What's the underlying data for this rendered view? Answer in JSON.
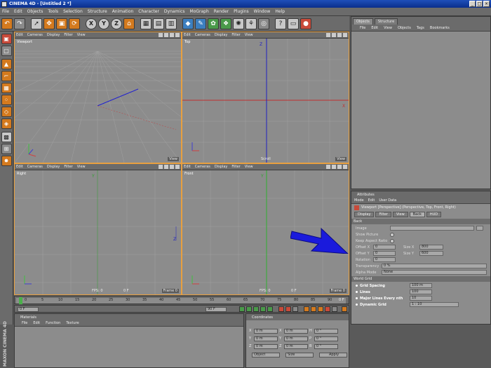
{
  "window": {
    "title": "CINEMA 4D - [Untitled 2 *]",
    "controls": [
      "_",
      "□",
      "×"
    ]
  },
  "menu": [
    "File",
    "Edit",
    "Objects",
    "Tools",
    "Selection",
    "Structure",
    "Animation",
    "Character",
    "Dynamics",
    "MoGraph",
    "Render",
    "Plugins",
    "Window",
    "Help"
  ],
  "viewports": {
    "top_left": {
      "menu": [
        "Edit",
        "Cameras",
        "Display",
        "Filter",
        "View"
      ],
      "label": "Viewport",
      "view_btn": "View"
    },
    "top_right": {
      "menu": [
        "Edit",
        "Cameras",
        "Display",
        "Filter",
        "View"
      ],
      "label": "Top",
      "view_btn": "View",
      "bottom": "Scroll"
    },
    "bottom_left": {
      "menu": [
        "Edit",
        "Cameras",
        "Display",
        "Filter",
        "View"
      ],
      "label": "Right",
      "fps": "FPS: 0",
      "fps2": "0 F",
      "view_btn": "Frame 0"
    },
    "bottom_right": {
      "menu": [
        "Edit",
        "Cameras",
        "Display",
        "Filter",
        "View"
      ],
      "label": "Front",
      "fps": "FPS: 0",
      "fps2": "0 F",
      "view_btn": "Frame 0"
    }
  },
  "objects_panel": {
    "tabs": [
      "Objects",
      "Structure"
    ],
    "menu": [
      "File",
      "Edit",
      "View",
      "Objects",
      "Tags",
      "Bookmarks"
    ]
  },
  "attributes_panel": {
    "title": "Attributes",
    "menu": [
      "Mode",
      "Edit",
      "User Data"
    ],
    "object_line": "Viewport [Perspective] (Perspective, Top, Front, Right)",
    "subtabs": [
      "Display",
      "Filter",
      "View",
      "Back",
      "HUD"
    ],
    "section_back": "Back",
    "image_label": "Image",
    "show_picture_label": "Show Picture",
    "keep_aspect_label": "Keep Aspect Ratio",
    "offset_x_label": "Offset X",
    "offset_x": "0",
    "size_x_label": "Size X",
    "size_x": "800",
    "offset_y_label": "Offset Y",
    "offset_y": "0",
    "size_y_label": "Size Y",
    "size_y": "600",
    "rotation_label": "Rotation",
    "rotation": "0",
    "transparency_label": "Transparency",
    "transparency": "0 %",
    "alpha_label": "Alpha Mode",
    "alpha": "None",
    "section_grid": "World Grid",
    "grid_spacing_label": "Grid Spacing",
    "grid_spacing": "100 m",
    "lines_label": "Lines",
    "lines": "100",
    "major_label": "Major Lines Every nth",
    "major": "10",
    "dynamic_label": "Dynamic Grid",
    "dynamic": "1 : 10"
  },
  "timeline": {
    "ticks": [
      "0",
      "5",
      "10",
      "15",
      "20",
      "25",
      "30",
      "35",
      "40",
      "45",
      "50",
      "55",
      "60",
      "65",
      "70",
      "75",
      "80",
      "85",
      "90"
    ],
    "end": "0 F"
  },
  "transport": {
    "start": "0 F",
    "end": "90 F"
  },
  "materials_panel": {
    "title": "Materials",
    "menu": [
      "File",
      "Edit",
      "Function",
      "Texture"
    ]
  },
  "coordinates_panel": {
    "title": "Coordinates",
    "rows": [
      {
        "a": "X",
        "av": "0 m",
        "b": "X",
        "bv": "0 m",
        "c": "H",
        "cv": "0 °"
      },
      {
        "a": "Y",
        "av": "0 m",
        "b": "Y",
        "bv": "0 m",
        "c": "P",
        "cv": "0 °"
      },
      {
        "a": "Z",
        "av": "0 m",
        "b": "Z",
        "bv": "0 m",
        "c": "B",
        "cv": "0 °"
      }
    ],
    "mode": "Object",
    "size_mode": "Size",
    "apply": "Apply"
  },
  "branding": {
    "logo": "MAXON CINEMA 4D"
  },
  "colors": {
    "accent": "#d47a1e",
    "arrow": "#1a1adc",
    "active_border": "#e8a040"
  }
}
